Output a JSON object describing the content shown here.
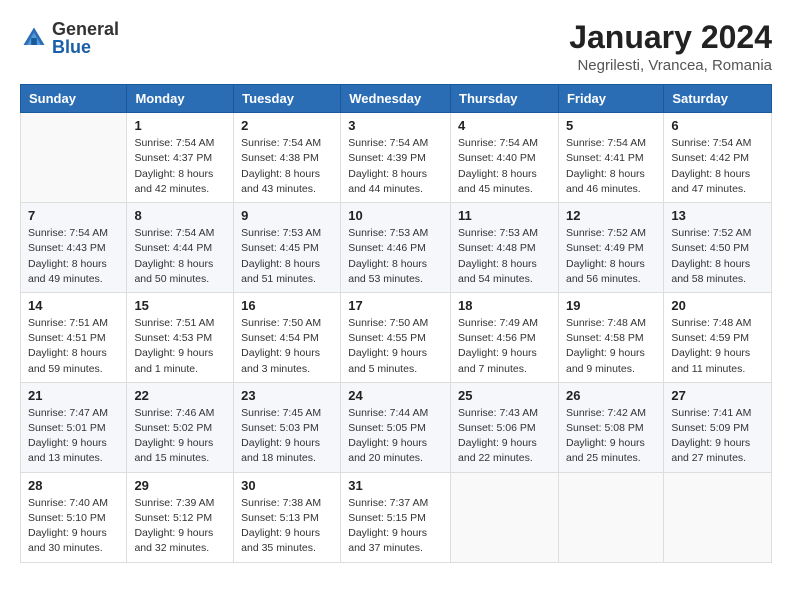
{
  "logo": {
    "text_general": "General",
    "text_blue": "Blue"
  },
  "header": {
    "title": "January 2024",
    "subtitle": "Negrilesti, Vrancea, Romania"
  },
  "weekdays": [
    "Sunday",
    "Monday",
    "Tuesday",
    "Wednesday",
    "Thursday",
    "Friday",
    "Saturday"
  ],
  "weeks": [
    [
      {
        "day": "",
        "info": ""
      },
      {
        "day": "1",
        "info": "Sunrise: 7:54 AM\nSunset: 4:37 PM\nDaylight: 8 hours\nand 42 minutes."
      },
      {
        "day": "2",
        "info": "Sunrise: 7:54 AM\nSunset: 4:38 PM\nDaylight: 8 hours\nand 43 minutes."
      },
      {
        "day": "3",
        "info": "Sunrise: 7:54 AM\nSunset: 4:39 PM\nDaylight: 8 hours\nand 44 minutes."
      },
      {
        "day": "4",
        "info": "Sunrise: 7:54 AM\nSunset: 4:40 PM\nDaylight: 8 hours\nand 45 minutes."
      },
      {
        "day": "5",
        "info": "Sunrise: 7:54 AM\nSunset: 4:41 PM\nDaylight: 8 hours\nand 46 minutes."
      },
      {
        "day": "6",
        "info": "Sunrise: 7:54 AM\nSunset: 4:42 PM\nDaylight: 8 hours\nand 47 minutes."
      }
    ],
    [
      {
        "day": "7",
        "info": "Sunrise: 7:54 AM\nSunset: 4:43 PM\nDaylight: 8 hours\nand 49 minutes."
      },
      {
        "day": "8",
        "info": "Sunrise: 7:54 AM\nSunset: 4:44 PM\nDaylight: 8 hours\nand 50 minutes."
      },
      {
        "day": "9",
        "info": "Sunrise: 7:53 AM\nSunset: 4:45 PM\nDaylight: 8 hours\nand 51 minutes."
      },
      {
        "day": "10",
        "info": "Sunrise: 7:53 AM\nSunset: 4:46 PM\nDaylight: 8 hours\nand 53 minutes."
      },
      {
        "day": "11",
        "info": "Sunrise: 7:53 AM\nSunset: 4:48 PM\nDaylight: 8 hours\nand 54 minutes."
      },
      {
        "day": "12",
        "info": "Sunrise: 7:52 AM\nSunset: 4:49 PM\nDaylight: 8 hours\nand 56 minutes."
      },
      {
        "day": "13",
        "info": "Sunrise: 7:52 AM\nSunset: 4:50 PM\nDaylight: 8 hours\nand 58 minutes."
      }
    ],
    [
      {
        "day": "14",
        "info": "Sunrise: 7:51 AM\nSunset: 4:51 PM\nDaylight: 8 hours\nand 59 minutes."
      },
      {
        "day": "15",
        "info": "Sunrise: 7:51 AM\nSunset: 4:53 PM\nDaylight: 9 hours\nand 1 minute."
      },
      {
        "day": "16",
        "info": "Sunrise: 7:50 AM\nSunset: 4:54 PM\nDaylight: 9 hours\nand 3 minutes."
      },
      {
        "day": "17",
        "info": "Sunrise: 7:50 AM\nSunset: 4:55 PM\nDaylight: 9 hours\nand 5 minutes."
      },
      {
        "day": "18",
        "info": "Sunrise: 7:49 AM\nSunset: 4:56 PM\nDaylight: 9 hours\nand 7 minutes."
      },
      {
        "day": "19",
        "info": "Sunrise: 7:48 AM\nSunset: 4:58 PM\nDaylight: 9 hours\nand 9 minutes."
      },
      {
        "day": "20",
        "info": "Sunrise: 7:48 AM\nSunset: 4:59 PM\nDaylight: 9 hours\nand 11 minutes."
      }
    ],
    [
      {
        "day": "21",
        "info": "Sunrise: 7:47 AM\nSunset: 5:01 PM\nDaylight: 9 hours\nand 13 minutes."
      },
      {
        "day": "22",
        "info": "Sunrise: 7:46 AM\nSunset: 5:02 PM\nDaylight: 9 hours\nand 15 minutes."
      },
      {
        "day": "23",
        "info": "Sunrise: 7:45 AM\nSunset: 5:03 PM\nDaylight: 9 hours\nand 18 minutes."
      },
      {
        "day": "24",
        "info": "Sunrise: 7:44 AM\nSunset: 5:05 PM\nDaylight: 9 hours\nand 20 minutes."
      },
      {
        "day": "25",
        "info": "Sunrise: 7:43 AM\nSunset: 5:06 PM\nDaylight: 9 hours\nand 22 minutes."
      },
      {
        "day": "26",
        "info": "Sunrise: 7:42 AM\nSunset: 5:08 PM\nDaylight: 9 hours\nand 25 minutes."
      },
      {
        "day": "27",
        "info": "Sunrise: 7:41 AM\nSunset: 5:09 PM\nDaylight: 9 hours\nand 27 minutes."
      }
    ],
    [
      {
        "day": "28",
        "info": "Sunrise: 7:40 AM\nSunset: 5:10 PM\nDaylight: 9 hours\nand 30 minutes."
      },
      {
        "day": "29",
        "info": "Sunrise: 7:39 AM\nSunset: 5:12 PM\nDaylight: 9 hours\nand 32 minutes."
      },
      {
        "day": "30",
        "info": "Sunrise: 7:38 AM\nSunset: 5:13 PM\nDaylight: 9 hours\nand 35 minutes."
      },
      {
        "day": "31",
        "info": "Sunrise: 7:37 AM\nSunset: 5:15 PM\nDaylight: 9 hours\nand 37 minutes."
      },
      {
        "day": "",
        "info": ""
      },
      {
        "day": "",
        "info": ""
      },
      {
        "day": "",
        "info": ""
      }
    ]
  ]
}
